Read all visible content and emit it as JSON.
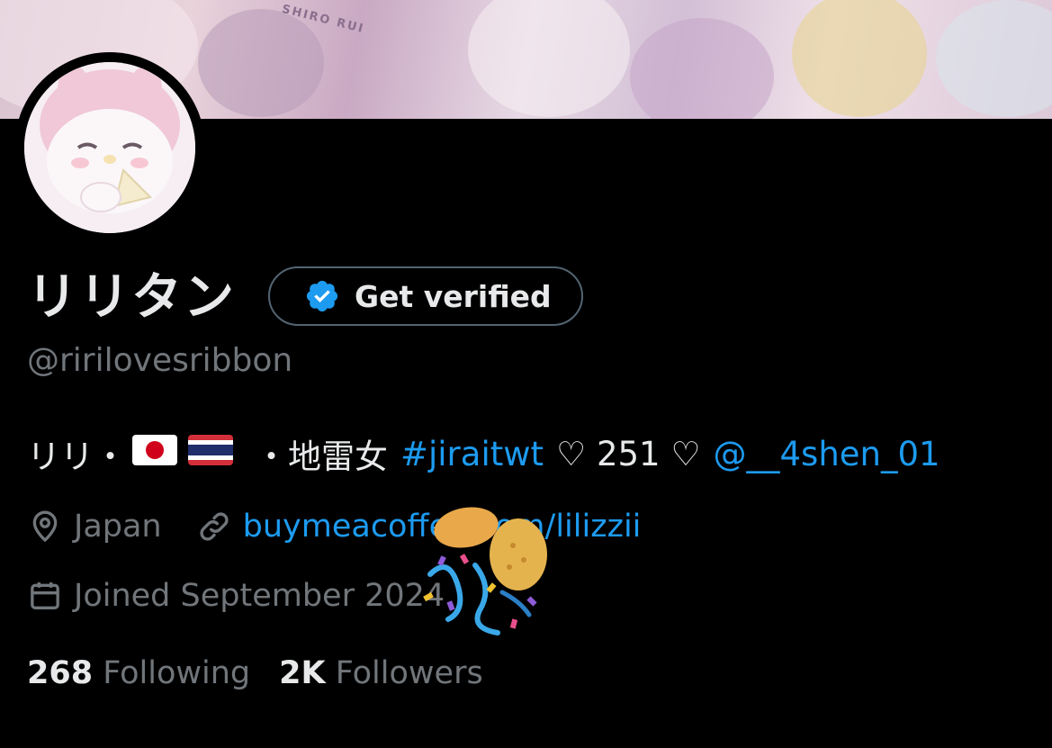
{
  "profile": {
    "banner_text": "SHIRO RUI",
    "display_name": "リリタン",
    "handle": "@ririlovesribbon",
    "get_verified_label": "Get verified",
    "bio": {
      "part1": "リリ・",
      "flag1": "Japan flag",
      "flag2": "Thailand flag",
      "part2": "・地雷女",
      "hashtag": "#jiraitwt",
      "part3": "♡ 251 ♡",
      "mention": "@__4shen_01"
    },
    "location": "Japan",
    "website": "buymeacoffee.com/lilizzii",
    "joined": "Joined September 2024",
    "following_count": "268",
    "following_label": "Following",
    "followers_count": "2K",
    "followers_label": "Followers"
  },
  "icons": {
    "location": "location-pin-icon",
    "link": "link-icon",
    "calendar": "calendar-icon",
    "badge": "verified-badge-icon",
    "confetti": "party-popper-confetti-icon"
  },
  "colors": {
    "background": "#000000",
    "text_primary": "#e7e9ea",
    "text_secondary": "#71767b",
    "accent": "#1d9bf0",
    "border": "#536471"
  }
}
